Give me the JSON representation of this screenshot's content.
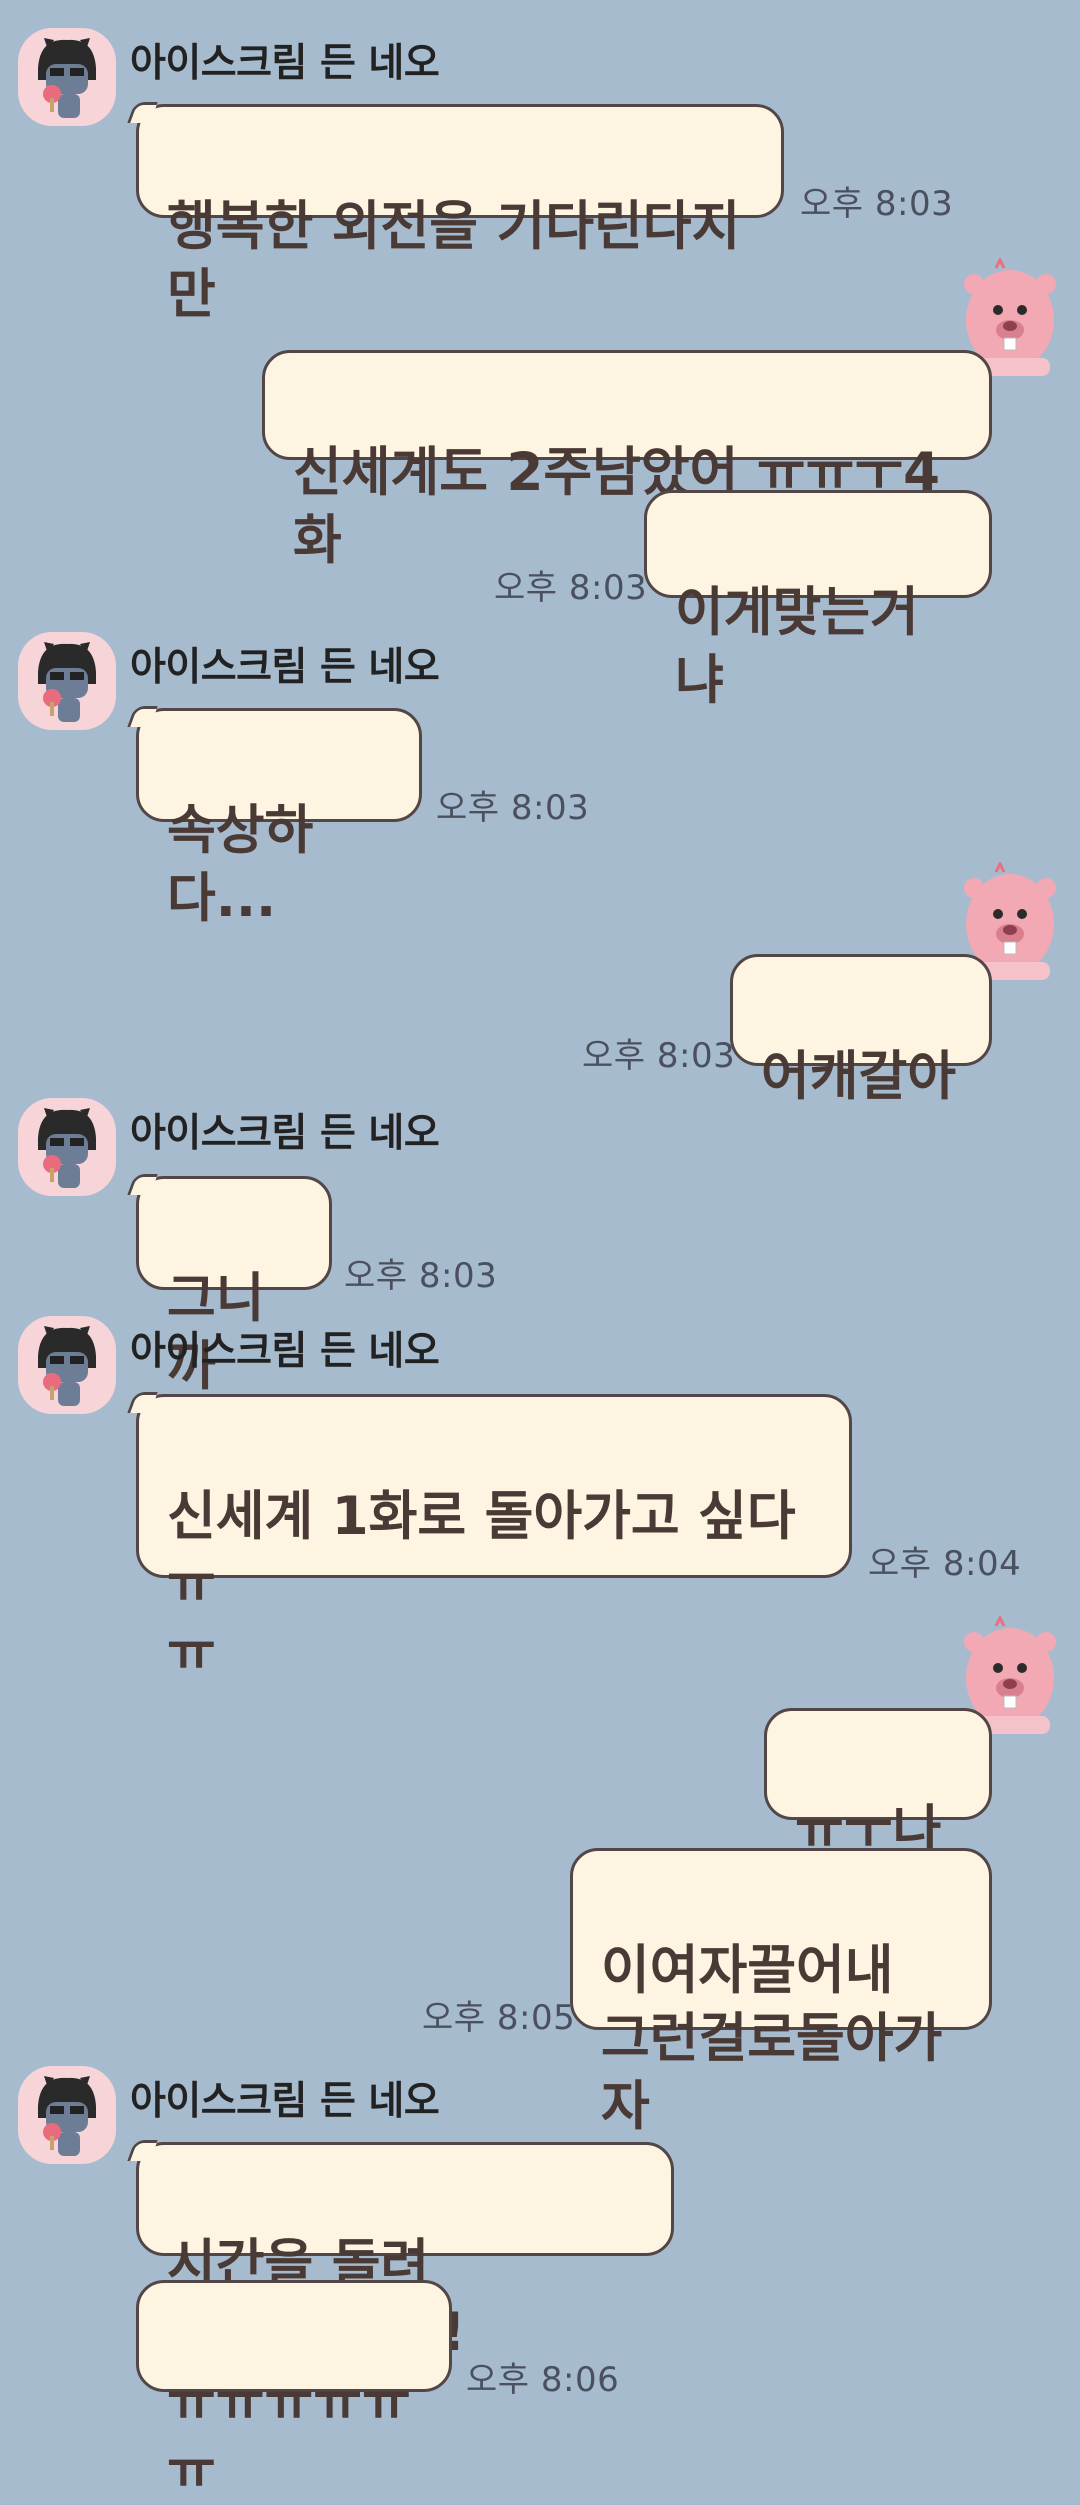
{
  "chat": {
    "sender_name": "아이스크림 든 네오",
    "messages": [
      {
        "text": "행복한 외전을 기다린다지만",
        "time": "오후 8:03"
      },
      {
        "text": "신세계도 2주남았어 ㅠㅠㅜ4화"
      },
      {
        "text": "이게맞는거냐",
        "time": "오후 8:03"
      },
      {
        "text": "속상하다...",
        "time": "오후 8:03"
      },
      {
        "text": "어캐갈아",
        "time": "오후 8:03"
      },
      {
        "text": "그니까",
        "time": "오후 8:03"
      },
      {
        "text": "신세계 1화로 돌아가고 싶다 ㅠ\nㅠ",
        "time": "오후 8:04"
      },
      {
        "text": "ㅠㅜ나도"
      },
      {
        "text": "이여자끌어내\n그런걸로돌아가자",
        "time": "오후 8:05"
      },
      {
        "text": "시간을 돌려~~~~!!!!!"
      },
      {
        "text": "ㅠㅠㅠㅠㅠㅠ",
        "time": "오후 8:06"
      }
    ]
  },
  "icons": {
    "other_avatar": "neo-icecream-avatar-icon",
    "my_avatar": "pink-beaver-sticker-icon"
  },
  "colors": {
    "background": "#a7bbcf",
    "bubble": "#fdf4e2",
    "bubble_border": "#524646",
    "text": "#4a3a36",
    "timestamp": "#4a5060"
  }
}
